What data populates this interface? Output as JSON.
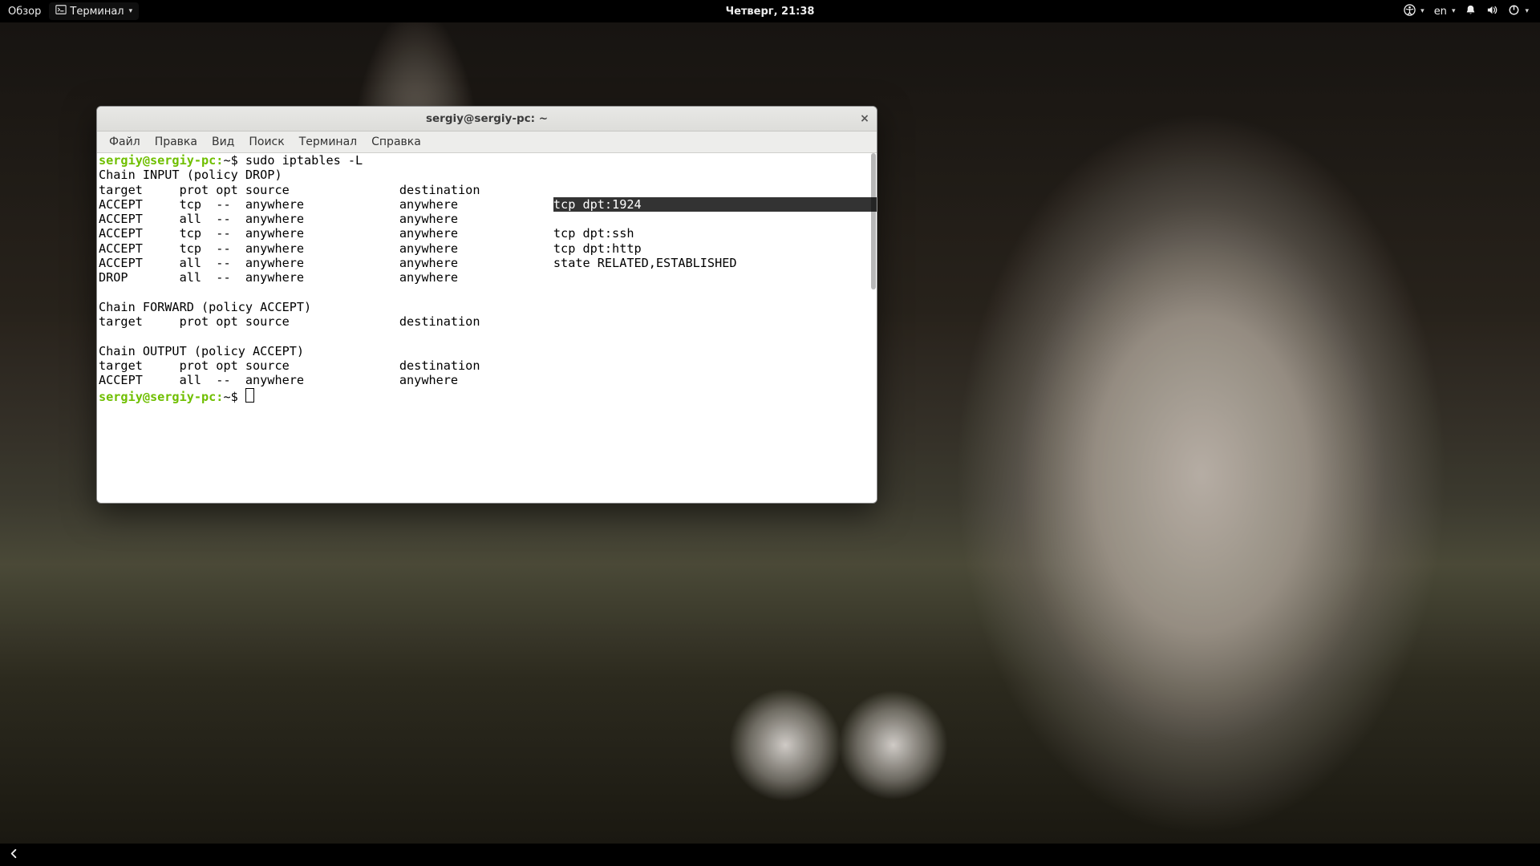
{
  "panel": {
    "activities": "Обзор",
    "active_app": "Терминал",
    "clock": "Четверг, 21:38",
    "lang": "en"
  },
  "window": {
    "title": "sergiy@sergiy-pc: ~",
    "menus": [
      "Файл",
      "Правка",
      "Вид",
      "Поиск",
      "Терминал",
      "Справка"
    ]
  },
  "term": {
    "prompt_user_host": "sergiy@sergiy-pc:",
    "prompt_path": "~$ ",
    "cmd1": "sudo iptables -L",
    "chain_input": "Chain INPUT (policy DROP)",
    "hdr": "target     prot opt source               destination",
    "r1a": "ACCEPT     tcp  --  anywhere             anywhere             ",
    "r1b": "tcp dpt:1924",
    "r2": "ACCEPT     all  --  anywhere             anywhere",
    "r3": "ACCEPT     tcp  --  anywhere             anywhere             tcp dpt:ssh",
    "r4": "ACCEPT     tcp  --  anywhere             anywhere             tcp dpt:http",
    "r5": "ACCEPT     all  --  anywhere             anywhere             state RELATED,ESTABLISHED",
    "r6": "DROP       all  --  anywhere             anywhere",
    "chain_forward": "Chain FORWARD (policy ACCEPT)",
    "chain_output": "Chain OUTPUT (policy ACCEPT)",
    "out_r1": "ACCEPT     all  --  anywhere             anywhere"
  }
}
